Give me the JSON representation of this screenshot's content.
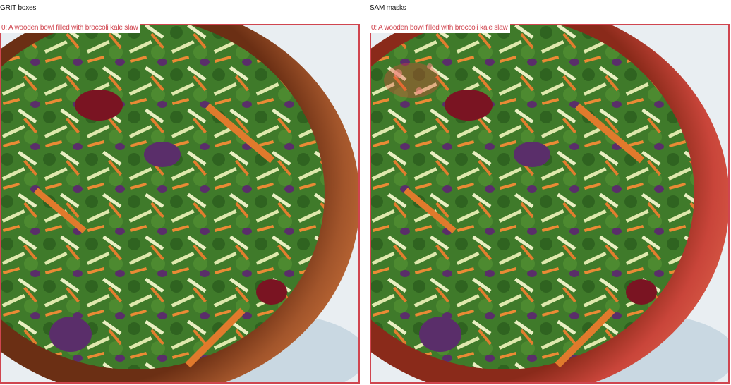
{
  "panels": [
    {
      "title": "GRIT boxes",
      "box_label": "0: A wooden bowl filled with broccoli kale slaw"
    },
    {
      "title": "SAM masks",
      "box_label": "0: A wooden bowl filled with broccoli kale slaw"
    }
  ],
  "colors": {
    "box_outline": "#d0454f",
    "mask_tint": "#e8453a",
    "bowl_wood": "#9a4a24",
    "kale": "#3f7a2a",
    "carrot": "#e07a2c",
    "broccoli_stem": "#d9e3a6",
    "red_cabbage": "#5a2e6a",
    "cranberry": "#7a1422"
  }
}
